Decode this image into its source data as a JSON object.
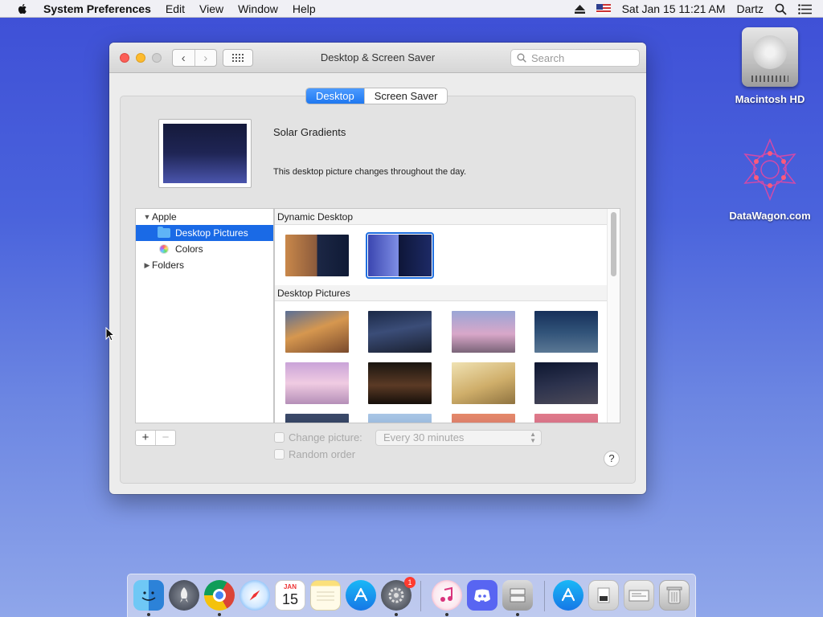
{
  "menubar": {
    "app_name": "System Preferences",
    "menus": [
      "Edit",
      "View",
      "Window",
      "Help"
    ],
    "datetime": "Sat Jan 15  11:21 AM",
    "user": "Dartz"
  },
  "desktop_icons": [
    {
      "label": "Macintosh HD"
    },
    {
      "label": "DataWagon.com"
    }
  ],
  "window": {
    "title": "Desktop & Screen Saver",
    "search_placeholder": "Search",
    "tabs": [
      {
        "label": "Desktop",
        "active": true
      },
      {
        "label": "Screen Saver",
        "active": false
      }
    ],
    "picture_name": "Solar Gradients",
    "picture_description": "This desktop picture changes throughout the day.",
    "source_list": [
      {
        "label": "Apple",
        "disclosure": "▼"
      },
      {
        "label": "Desktop Pictures",
        "selected": true
      },
      {
        "label": "Colors"
      },
      {
        "label": "Folders",
        "disclosure": "▶"
      }
    ],
    "sections": [
      {
        "title": "Dynamic Desktop"
      },
      {
        "title": "Desktop Pictures"
      }
    ],
    "add_button": "+",
    "remove_button": "−",
    "change_picture_label": "Change picture:",
    "interval_value": "Every 30 minutes",
    "random_order_label": "Random order",
    "help_label": "?"
  },
  "dock": {
    "calendar_month": "JAN",
    "calendar_day": "15",
    "prefs_badge": "1"
  },
  "colors": {
    "accent": "#1a6ae6",
    "close": "#fc5f57",
    "minimize": "#fdbb2e"
  }
}
